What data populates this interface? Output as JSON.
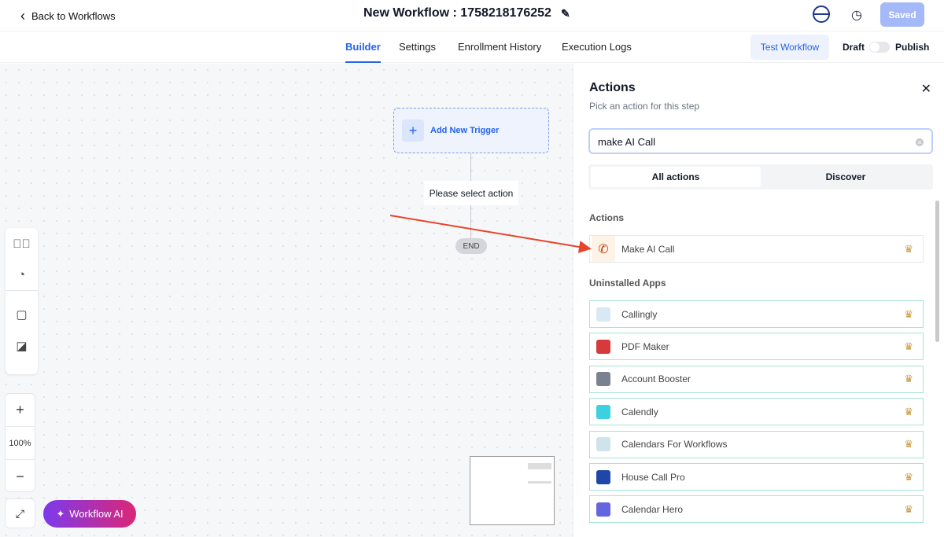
{
  "header": {
    "back_label": "Back to Workflows",
    "title": "New Workflow : 1758218176252",
    "saved_label": "Saved"
  },
  "tabs": [
    {
      "label": "Builder"
    },
    {
      "label": "Settings"
    },
    {
      "label": "Enrollment History"
    },
    {
      "label": "Execution Logs"
    }
  ],
  "nav": {
    "test_label": "Test Workflow",
    "draft_label": "Draft",
    "publish_label": "Publish"
  },
  "canvas": {
    "trigger_label": "Add New Trigger",
    "select_action": "Please select action",
    "end_label": "END",
    "zoom": "100%",
    "ai_label": "Workflow AI"
  },
  "panel": {
    "title": "Actions",
    "subtitle": "Pick an action for this step",
    "search_value": "make AI Call",
    "seg_all": "All actions",
    "seg_discover": "Discover",
    "actions_heading": "Actions",
    "uninstalled_heading": "Uninstalled Apps",
    "action": {
      "label": "Make AI Call"
    },
    "apps": [
      {
        "label": "Callingly",
        "color": "#d8e8f5"
      },
      {
        "label": "PDF Maker",
        "color": "#d63a3a"
      },
      {
        "label": "Account Booster",
        "color": "#7a8190"
      },
      {
        "label": "Calendly",
        "color": "#3cd0e0"
      },
      {
        "label": "Calendars For Workflows",
        "color": "#cfe3ea"
      },
      {
        "label": "House Call Pro",
        "color": "#1f47a8"
      },
      {
        "label": "Calendar Hero",
        "color": "#6565e0"
      }
    ]
  }
}
